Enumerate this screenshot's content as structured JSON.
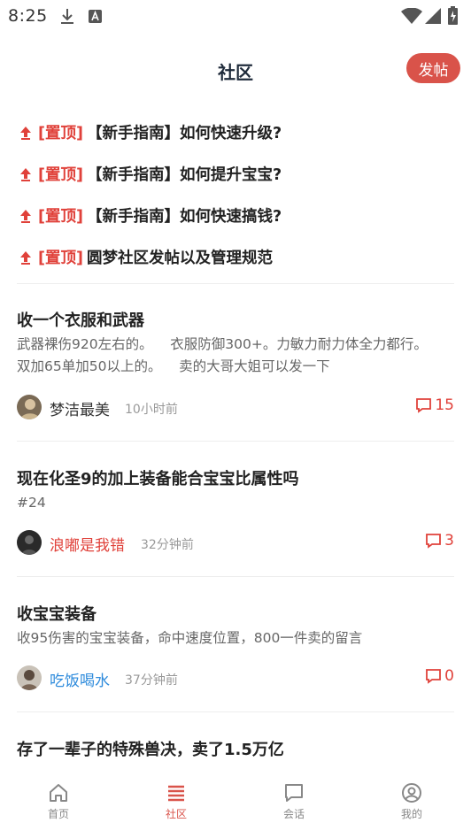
{
  "status_bar": {
    "time": "8:25"
  },
  "header": {
    "title": "社区",
    "post_button": "发帖"
  },
  "pinned": [
    {
      "tag": "[置顶]",
      "title": "【新手指南】如何快速升级?"
    },
    {
      "tag": "[置顶]",
      "title": "【新手指南】如何提升宝宝?"
    },
    {
      "tag": "[置顶]",
      "title": "【新手指南】如何快速搞钱?"
    },
    {
      "tag": "[置顶]",
      "title": "圆梦社区发帖以及管理规范"
    }
  ],
  "posts": [
    {
      "title": "收一个衣服和武器",
      "body_line1": "武器裸伤920左右的。    衣服防御300+。力敏力耐力体全力都行。",
      "body_line2": "双加65单加50以上的。    卖的大哥大姐可以发一下",
      "author": "梦洁最美",
      "author_color": "#333333",
      "time": "10小时前",
      "comments": "15"
    },
    {
      "title": "现在化圣9的加上装备能合宝宝比属性吗",
      "body_line1": "#24",
      "author": "浪嘟是我错",
      "author_color": "#e0413a",
      "time": "32分钟前",
      "comments": "3"
    },
    {
      "title": "收宝宝装备",
      "body_line1": "收95伤害的宝宝装备，命中速度位置，800一件卖的留言",
      "author": "吃饭喝水",
      "author_color": "#2e8bdc",
      "time": "37分钟前",
      "comments": "0"
    },
    {
      "title": "存了一辈子的特殊兽决，卖了1.5万亿"
    }
  ],
  "tabs": [
    {
      "label": "首页",
      "icon": "home-icon"
    },
    {
      "label": "社区",
      "icon": "list-icon"
    },
    {
      "label": "会话",
      "icon": "chat-icon"
    },
    {
      "label": "我的",
      "icon": "profile-icon"
    }
  ],
  "colors": {
    "accent": "#d9534a",
    "pinned_tag": "#e0413a",
    "title": "#1e2a3a"
  }
}
